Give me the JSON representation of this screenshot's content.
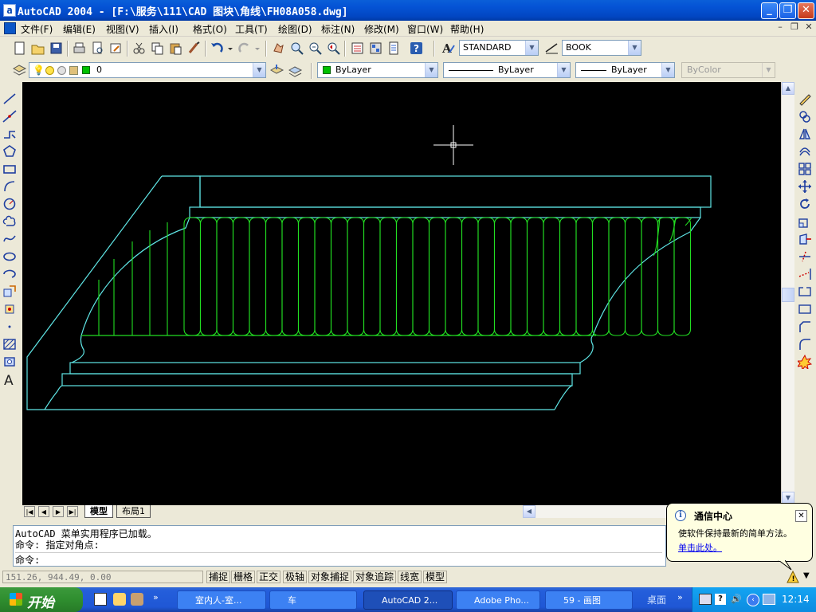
{
  "window": {
    "title": "AutoCAD 2004 - [F:\\服务\\111\\CAD 图块\\角线\\FH08A058.dwg]",
    "app_icon_glyph": "a",
    "minimize_glyph": "_",
    "maximize_glyph": "❐",
    "close_glyph": "✕"
  },
  "menu": {
    "items": [
      "文件(F)",
      "编辑(E)",
      "视图(V)",
      "插入(I)",
      "格式(O)",
      "工具(T)",
      "绘图(D)",
      "标注(N)",
      "修改(M)",
      "窗口(W)",
      "帮助(H)"
    ],
    "doc_controls": [
      "–",
      "❐",
      "✕"
    ]
  },
  "standard_toolbar": {
    "text_style": "STANDARD",
    "dim_style": "BOOK"
  },
  "layers_toolbar": {
    "layer_name": "0",
    "color": "ByLayer",
    "linetype": "ByLayer",
    "lineweight": "ByLayer",
    "plotstyle": "ByColor"
  },
  "tabs": {
    "model": "模型",
    "layout1": "布局1"
  },
  "command": {
    "lines": [
      "AutoCAD 菜单实用程序已加载。",
      "命令: 指定对角点:",
      "命令:"
    ]
  },
  "status": {
    "coords": "151.26, 944.49, 0.00",
    "toggles": [
      "捕捉",
      "栅格",
      "正交",
      "极轴",
      "对象捕捉",
      "对象追踪",
      "线宽",
      "模型"
    ]
  },
  "balloon": {
    "title": "通信中心",
    "body": "使软件保持最新的简单方法。",
    "link": "单击此处。",
    "close_glyph": "✕"
  },
  "taskbar": {
    "start": "开始",
    "tasks": [
      {
        "label": "室内人-室..."
      },
      {
        "label": "车"
      },
      {
        "label": "AutoCAD 2..."
      },
      {
        "label": "Adobe Pho..."
      },
      {
        "label": "59 - 画图"
      }
    ],
    "desktop": "桌面",
    "clock": "12:14"
  },
  "colors": {
    "outline": "#5fe6e6",
    "flutes": "#22dd22",
    "canvas_bg": "#000000",
    "layer_color": "#00c000"
  }
}
